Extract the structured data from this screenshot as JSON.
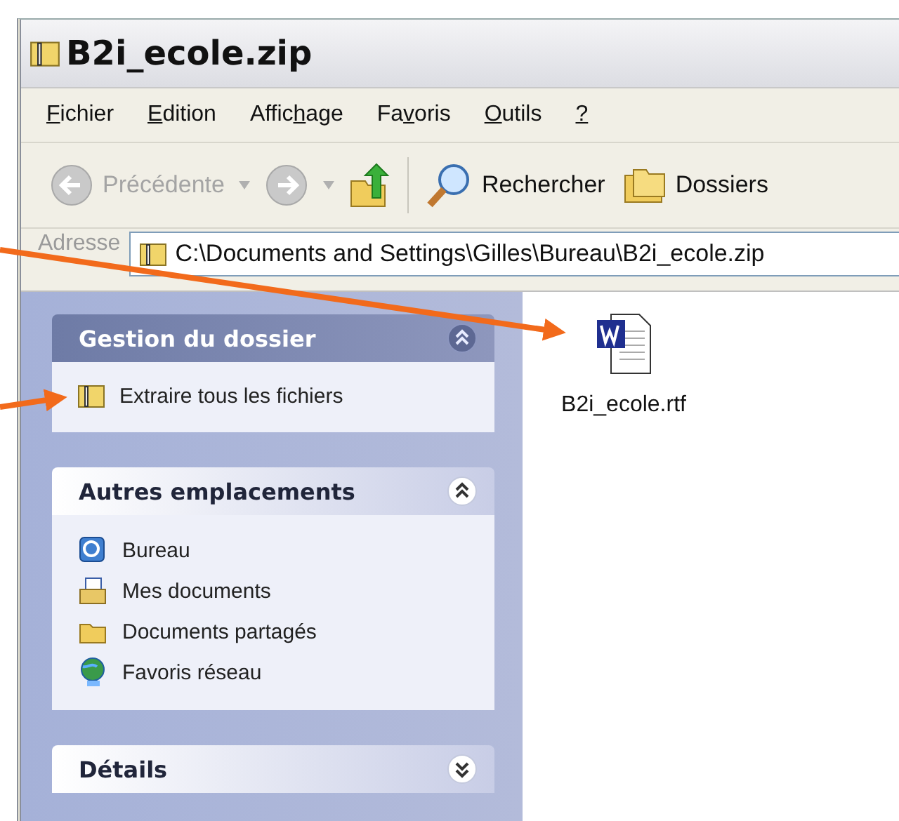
{
  "window": {
    "title": "B2i_ecole.zip"
  },
  "menu": [
    {
      "key": "F",
      "post": "ichier"
    },
    {
      "key": "E",
      "post": "dition"
    },
    {
      "pre": "Affic",
      "key": "h",
      "post": "age"
    },
    {
      "pre": "Fa",
      "key": "v",
      "post": "oris"
    },
    {
      "key": "O",
      "post": "utils"
    },
    {
      "key": "?"
    }
  ],
  "toolbar": [
    {
      "kind": "back",
      "label": "Précédente",
      "disabled": true
    },
    {
      "kind": "forward",
      "disabled": true
    },
    {
      "kind": "up"
    },
    {
      "kind": "search",
      "label": "Rechercher"
    },
    {
      "kind": "folders",
      "label": "Dossiers"
    }
  ],
  "address": {
    "label": "Adresse",
    "value": "C:\\Documents and Settings\\Gilles\\Bureau\\B2i_ecole.zip"
  },
  "tasks": [
    {
      "title": "Gestion du dossier",
      "kind": "primary",
      "expanded": true,
      "items": [
        {
          "label": "Extraire tous les fichiers",
          "kind": "zip"
        }
      ]
    },
    {
      "title": "Autres emplacements",
      "kind": "normal",
      "expanded": true,
      "items": [
        {
          "label": "Bureau",
          "kind": "desktop"
        },
        {
          "label": "Mes documents",
          "kind": "documents"
        },
        {
          "label": "Documents partagés",
          "kind": "folder"
        },
        {
          "label": "Favoris réseau",
          "kind": "network"
        }
      ]
    },
    {
      "title": "Détails",
      "kind": "normal",
      "expanded": false
    }
  ],
  "files": [
    {
      "name": "B2i_ecole.rtf"
    }
  ]
}
